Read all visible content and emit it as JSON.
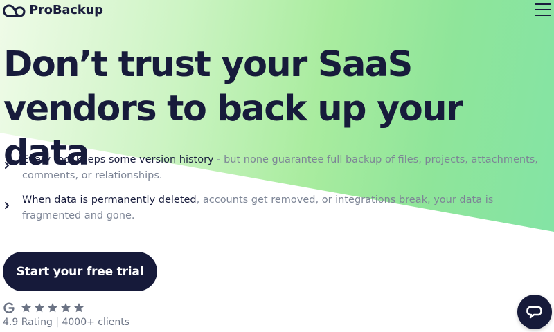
{
  "brand": {
    "name": "ProBackup"
  },
  "nav": {
    "menu_icon": "hamburger-menu-icon"
  },
  "hero": {
    "headline": "Don’t trust your SaaS vendors to back up your data",
    "points": [
      {
        "strong": "Every tool keeps some version history",
        "muted": " - but none guarantee full backup of files, projects, attachments, comments, or relationships."
      },
      {
        "strong": "When data is permanently deleted",
        "muted": ", accounts get removed, or integrations break, your data is fragmented and gone."
      }
    ],
    "cta_label": "Start your free trial"
  },
  "rating": {
    "source_icon": "g2-icon",
    "stars": 5,
    "text": "4.9 Rating | 4000+ clients"
  },
  "chat": {
    "icon": "chat-bubble-icon"
  },
  "colors": {
    "primary_dark": "#161a3a",
    "muted_text": "#7d8596",
    "gradient_start": "#effbe8",
    "gradient_end": "#82e4a6",
    "star_color": "#6b7384"
  }
}
